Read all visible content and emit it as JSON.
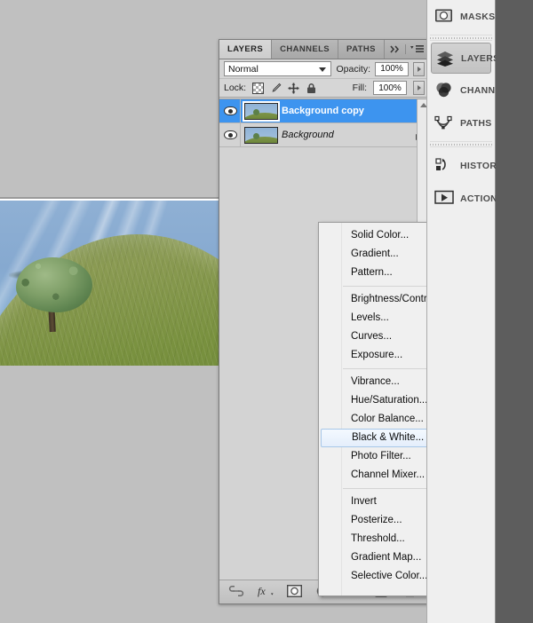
{
  "app": {
    "background_color": "#c0c0c0",
    "dock_far_color": "#5d5d5d"
  },
  "document_window": {
    "name": "image-canvas",
    "image_description": "Lone tree on a grassy hillside under blue sky with cirrus clouds"
  },
  "layers_panel": {
    "tabs": [
      {
        "label": "LAYERS",
        "active": true
      },
      {
        "label": "CHANNELS",
        "active": false
      },
      {
        "label": "PATHS",
        "active": false
      }
    ],
    "collapse_icon": "double-chevron-right-icon",
    "menu_icon": "panel-menu-icon",
    "blend_mode": "Normal",
    "opacity_label": "Opacity:",
    "opacity_value": "100%",
    "lock_label": "Lock:",
    "lock_icons": [
      "lock-transparent-pixels-icon",
      "lock-image-pixels-icon",
      "lock-position-icon",
      "lock-all-icon"
    ],
    "fill_label": "Fill:",
    "fill_value": "100%",
    "layers": [
      {
        "name": "Background copy",
        "selected": true,
        "visible": true,
        "locked": false,
        "italic": false
      },
      {
        "name": "Background",
        "selected": false,
        "visible": true,
        "locked": true,
        "italic": true
      }
    ],
    "bottom_buttons": [
      "link-layers-icon",
      "layer-style-fx-icon",
      "add-layer-mask-icon",
      "new-adjustment-layer-icon",
      "new-group-icon",
      "new-layer-icon",
      "delete-layer-icon"
    ],
    "selected_color": "#3d94ef"
  },
  "adjustment_menu": {
    "highlight_color": "#e4eefb",
    "highlight_border": "#a8c7e8",
    "groups": [
      {
        "items": [
          {
            "label": "Solid Color...",
            "highlighted": false
          },
          {
            "label": "Gradient...",
            "highlighted": false
          },
          {
            "label": "Pattern...",
            "highlighted": false
          }
        ]
      },
      {
        "items": [
          {
            "label": "Brightness/Contrast...",
            "highlighted": false
          },
          {
            "label": "Levels...",
            "highlighted": false
          },
          {
            "label": "Curves...",
            "highlighted": false
          },
          {
            "label": "Exposure...",
            "highlighted": false
          }
        ]
      },
      {
        "items": [
          {
            "label": "Vibrance...",
            "highlighted": false
          },
          {
            "label": "Hue/Saturation...",
            "highlighted": false
          },
          {
            "label": "Color Balance...",
            "highlighted": false
          },
          {
            "label": "Black & White...",
            "highlighted": true
          },
          {
            "label": "Photo Filter...",
            "highlighted": false
          },
          {
            "label": "Channel Mixer...",
            "highlighted": false
          }
        ]
      },
      {
        "items": [
          {
            "label": "Invert",
            "highlighted": false
          },
          {
            "label": "Posterize...",
            "highlighted": false
          },
          {
            "label": "Threshold...",
            "highlighted": false
          },
          {
            "label": "Gradient Map...",
            "highlighted": false
          },
          {
            "label": "Selective Color...",
            "highlighted": false
          }
        ]
      }
    ]
  },
  "dock": {
    "groups": [
      {
        "items": [
          {
            "label": "MASKS",
            "icon": "masks-icon",
            "active": false
          }
        ]
      },
      {
        "items": [
          {
            "label": "LAYERS",
            "icon": "layers-icon",
            "active": true
          },
          {
            "label": "CHANNELS",
            "icon": "channels-icon",
            "active": false
          },
          {
            "label": "PATHS",
            "icon": "paths-icon",
            "active": false
          }
        ]
      },
      {
        "items": [
          {
            "label": "HISTORY",
            "icon": "history-icon",
            "active": false
          },
          {
            "label": "ACTIONS",
            "icon": "actions-icon",
            "active": false
          }
        ]
      }
    ]
  }
}
